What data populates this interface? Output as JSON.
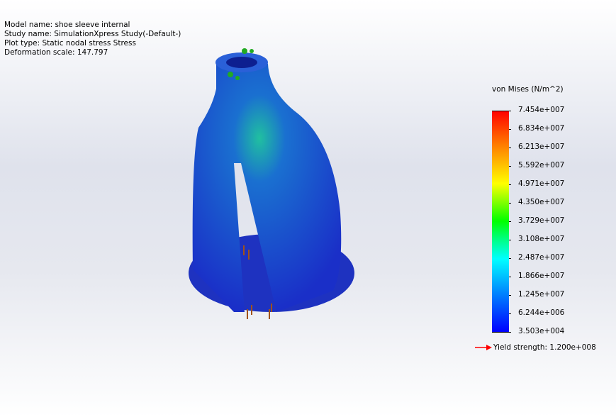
{
  "info": {
    "model_name": "Model name: shoe sleeve internal",
    "study_name": "Study name: SimulationXpress Study(-Default-)",
    "plot_type": "Plot type: Static nodal stress Stress",
    "deformation_scale": "Deformation scale: 147.797"
  },
  "legend": {
    "title": "von Mises (N/m^2)",
    "labels": [
      "7.454e+007",
      "6.834e+007",
      "6.213e+007",
      "5.592e+007",
      "4.971e+007",
      "4.350e+007",
      "3.729e+007",
      "3.108e+007",
      "2.487e+007",
      "1.866e+007",
      "1.245e+007",
      "6.244e+006",
      "3.503e+004"
    ],
    "yield": "Yield strength: 1.200e+008",
    "yield_color": "#ff0000"
  }
}
